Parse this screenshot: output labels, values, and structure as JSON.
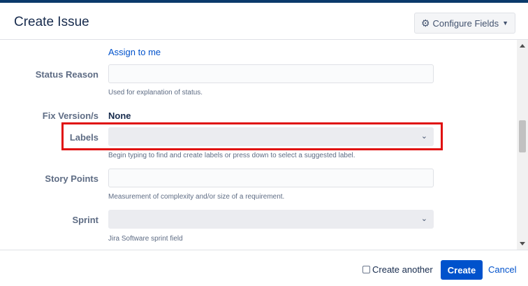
{
  "dialog": {
    "title": "Create Issue",
    "configure_fields_label": "Configure Fields"
  },
  "form": {
    "assign_to_me": "Assign to me",
    "status_reason": {
      "label": "Status Reason",
      "value": "",
      "help": "Used for explanation of status."
    },
    "fix_versions": {
      "label": "Fix Version/s",
      "value": "None"
    },
    "labels": {
      "label": "Labels",
      "value": "",
      "help": "Begin typing to find and create labels or press down to select a suggested label."
    },
    "story_points": {
      "label": "Story Points",
      "value": "",
      "help": "Measurement of complexity and/or size of a requirement."
    },
    "sprint": {
      "label": "Sprint",
      "value": "",
      "help": "Jira Software sprint field"
    }
  },
  "footer": {
    "create_another_label": "Create another",
    "create_another_checked": false,
    "create_label": "Create",
    "cancel_label": "Cancel"
  },
  "colors": {
    "primary": "#0052cc",
    "highlight_box": "#e01010",
    "top_band": "#0a3a6b"
  },
  "icons": {
    "configure": "gear-icon",
    "dropdown": "chevron-down-icon"
  }
}
